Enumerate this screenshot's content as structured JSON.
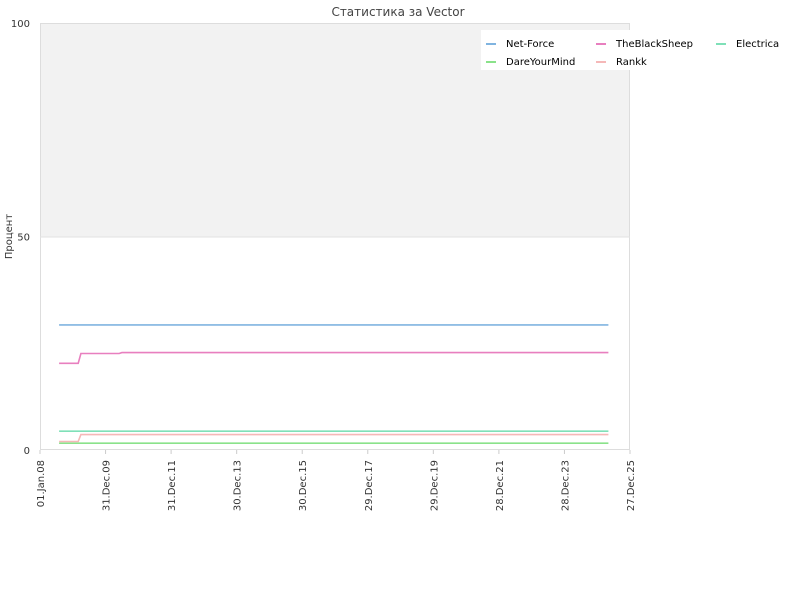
{
  "chart_data": {
    "type": "line",
    "title": "Статистика за Vector",
    "xlabel": "",
    "ylabel": "Процент",
    "ylim": [
      0,
      100
    ],
    "yticks": [
      "0",
      "50",
      "100"
    ],
    "xlim": [
      "2008-01-01",
      "2025-12-27"
    ],
    "xticks": [
      "01.Jan.08",
      "31.Dec.09",
      "31.Dec.11",
      "30.Dec.13",
      "30.Dec.15",
      "29.Dec.17",
      "29.Dec.19",
      "28.Dec.21",
      "28.Dec.23",
      "27.Dec.25"
    ],
    "grid": true,
    "legend_position": "top-right",
    "series": [
      {
        "name": "Net-Force",
        "color": "#80b4e0",
        "points": [
          [
            "2008-08-01",
            29.3
          ],
          [
            "2025-05-01",
            29.3
          ]
        ]
      },
      {
        "name": "TheBlackSheep",
        "color": "#e87fbf",
        "points": [
          [
            "2008-08-01",
            20.3
          ],
          [
            "2009-03-01",
            20.3
          ],
          [
            "2009-04-01",
            22.6
          ],
          [
            "2010-06-01",
            22.6
          ],
          [
            "2010-07-01",
            22.8
          ],
          [
            "2025-05-01",
            22.8
          ]
        ]
      },
      {
        "name": "Electrica",
        "color": "#7fe0b8",
        "points": [
          [
            "2008-08-01",
            4.4
          ],
          [
            "2025-05-01",
            4.4
          ]
        ]
      },
      {
        "name": "DareYourMind",
        "color": "#8ae28a",
        "points": [
          [
            "2008-08-01",
            1.6
          ],
          [
            "2025-05-01",
            1.6
          ]
        ]
      },
      {
        "name": "Rankk",
        "color": "#f5b8b8",
        "points": [
          [
            "2008-08-01",
            2.0
          ],
          [
            "2009-03-01",
            2.0
          ],
          [
            "2009-04-01",
            3.6
          ],
          [
            "2025-05-01",
            3.6
          ]
        ]
      }
    ]
  }
}
